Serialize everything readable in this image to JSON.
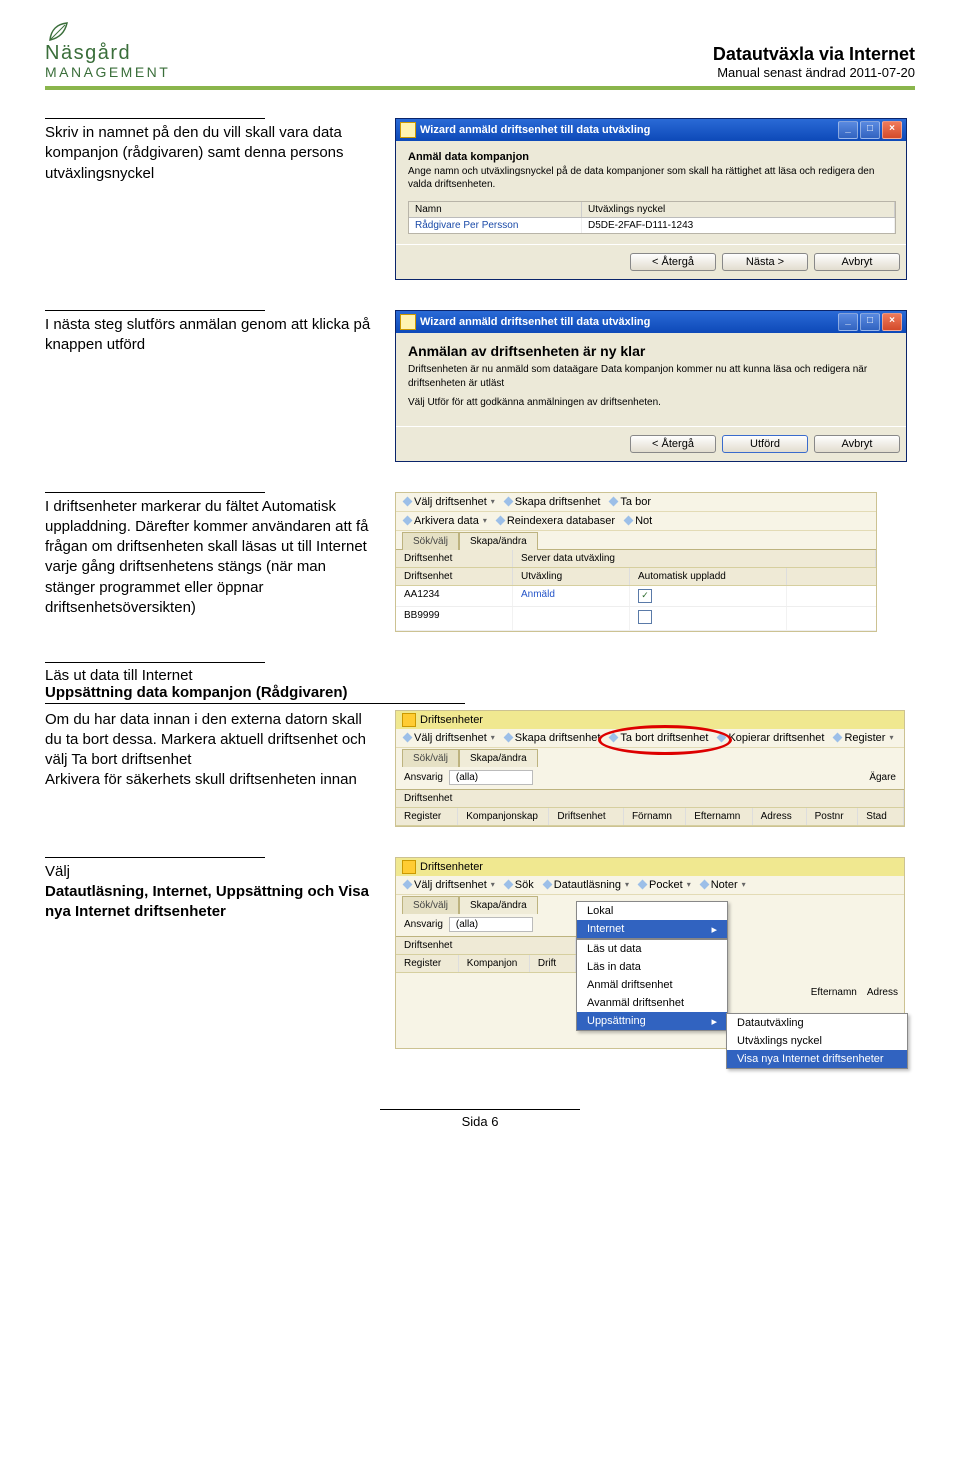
{
  "header": {
    "logo_line1": "Näsgård",
    "logo_line2": "MANAGEMENT",
    "title": "Datautväxla via Internet",
    "subtitle": "Manual senast ändrad 2011-07-20"
  },
  "section1": {
    "text": "Skriv in namnet på den du vill skall vara data kompanjon (rådgivaren) samt denna persons utväxlingsnyckel",
    "win_title": "Wizard anmäld driftsenhet till data utväxling",
    "wiz_h": "Anmäl data kompanjon",
    "wiz_sub": "Ange namn och utväxlingsnyckel på de data kompanjoner som skall ha rättighet att läsa och redigera den valda driftsenheten.",
    "col_name": "Namn",
    "col_key": "Utväxlings nyckel",
    "row_name": "Rådgivare Per Persson",
    "row_key": "D5DE-2FAF-D111-1243",
    "btn_back": "< Återgå",
    "btn_next": "Nästa >",
    "btn_cancel": "Avbryt"
  },
  "section2": {
    "text": "I nästa steg slutförs anmälan genom att klicka på knappen utförd",
    "win_title": "Wizard anmäld driftsenhet till data utväxling",
    "h": "Anmälan av driftsenheten är ny klar",
    "p1": "Driftsenheten är nu anmäld som dataägare Data kompanjon kommer nu att kunna läsa och redigera när driftsenheten är utläst",
    "p2": "Välj Utför för att godkänna anmälningen av driftsenheten.",
    "btn_back": "< Återgå",
    "btn_do": "Utförd",
    "btn_cancel": "Avbryt"
  },
  "section3": {
    "text": "I driftsenheter markerar du fältet Automatisk uppladdning. Därefter kommer användaren att få frågan om driftsenheten skall läsas ut till Internet varje gång driftsenhetens stängs (när man stänger programmet eller öppnar driftsenhetsöversikten)",
    "tb1": {
      "a": "Välj driftsenhet",
      "b": "Skapa driftsenhet",
      "c": "Ta bor"
    },
    "tb2": {
      "a": "Arkivera data",
      "b": "Reindexera databaser",
      "c": "Not"
    },
    "tab1": "Sök/välj",
    "tab2": "Skapa/ändra",
    "th1": "Driftsenhet",
    "th2": "Server data utväxling",
    "sub_th1": "Driftsenhet",
    "sub_th2": "Utväxling",
    "sub_th3": "Automatisk uppladd",
    "r1": {
      "a": "AA1234",
      "b": "Anmäld",
      "c": "✓"
    },
    "r2": {
      "a": "BB9999",
      "b": "",
      "c": ""
    }
  },
  "section4": {
    "h1": "Läs ut data till Internet",
    "h2": "Uppsättning data kompanjon (Rådgivaren)",
    "text": "Om du har data innan i den externa datorn skall du ta bort dessa. Markera aktuell driftsenhet och välj Ta bort driftsenhet\nArkivera för säkerhets skull driftsenheten innan",
    "win_title": "Driftsenheter",
    "tb": {
      "a": "Välj driftsenhet",
      "b": "Skapa driftsenhet",
      "c": "Ta bort driftsenhet",
      "d": "Kopierar driftsenhet",
      "e": "Register"
    },
    "tab1": "Sök/välj",
    "tab2": "Skapa/ändra",
    "ansvarig_lbl": "Ansvarig",
    "ansvarig_val": "(alla)",
    "agare": "Ägare",
    "th_de": "Driftsenhet",
    "cols": {
      "a": "Register",
      "b": "Kompanjonskap",
      "c": "Driftsenhet",
      "d": "Förnamn",
      "e": "Efternamn",
      "f": "Adress",
      "g": "Postnr",
      "h": "Stad"
    }
  },
  "section5": {
    "text": "Välj",
    "bold": "Datautläsning, Internet, Uppsättning och Visa nya Internet driftsenheter",
    "win_title": "Driftsenheter",
    "tb": {
      "a": "Välj driftsenhet",
      "b": "Sök",
      "c": "Datautläsning",
      "d": "Pocket",
      "e": "Noter"
    },
    "tab1": "Sök/välj",
    "tab2": "Skapa/ändra",
    "ansvarig_lbl": "Ansvarig",
    "ansvarig_val": "(alla)",
    "th_de": "Driftsenhet",
    "cols": {
      "a": "Register",
      "b": "Kompanjon",
      "c": "Drift",
      "d": "Efternamn",
      "e": "Adress"
    },
    "menu": {
      "lokal": "Lokal",
      "internet": "Internet",
      "m1": "Läs ut data",
      "m2": "Läs in data",
      "m3": "Anmäl driftsenhet",
      "m4": "Avanmäl driftsenhet",
      "m5": "Uppsättning"
    },
    "submenu": {
      "s1": "Datautväxling",
      "s2": "Utväxlings nyckel",
      "s3": "Visa nya Internet driftsenheter"
    }
  },
  "footer": "Sida 6"
}
